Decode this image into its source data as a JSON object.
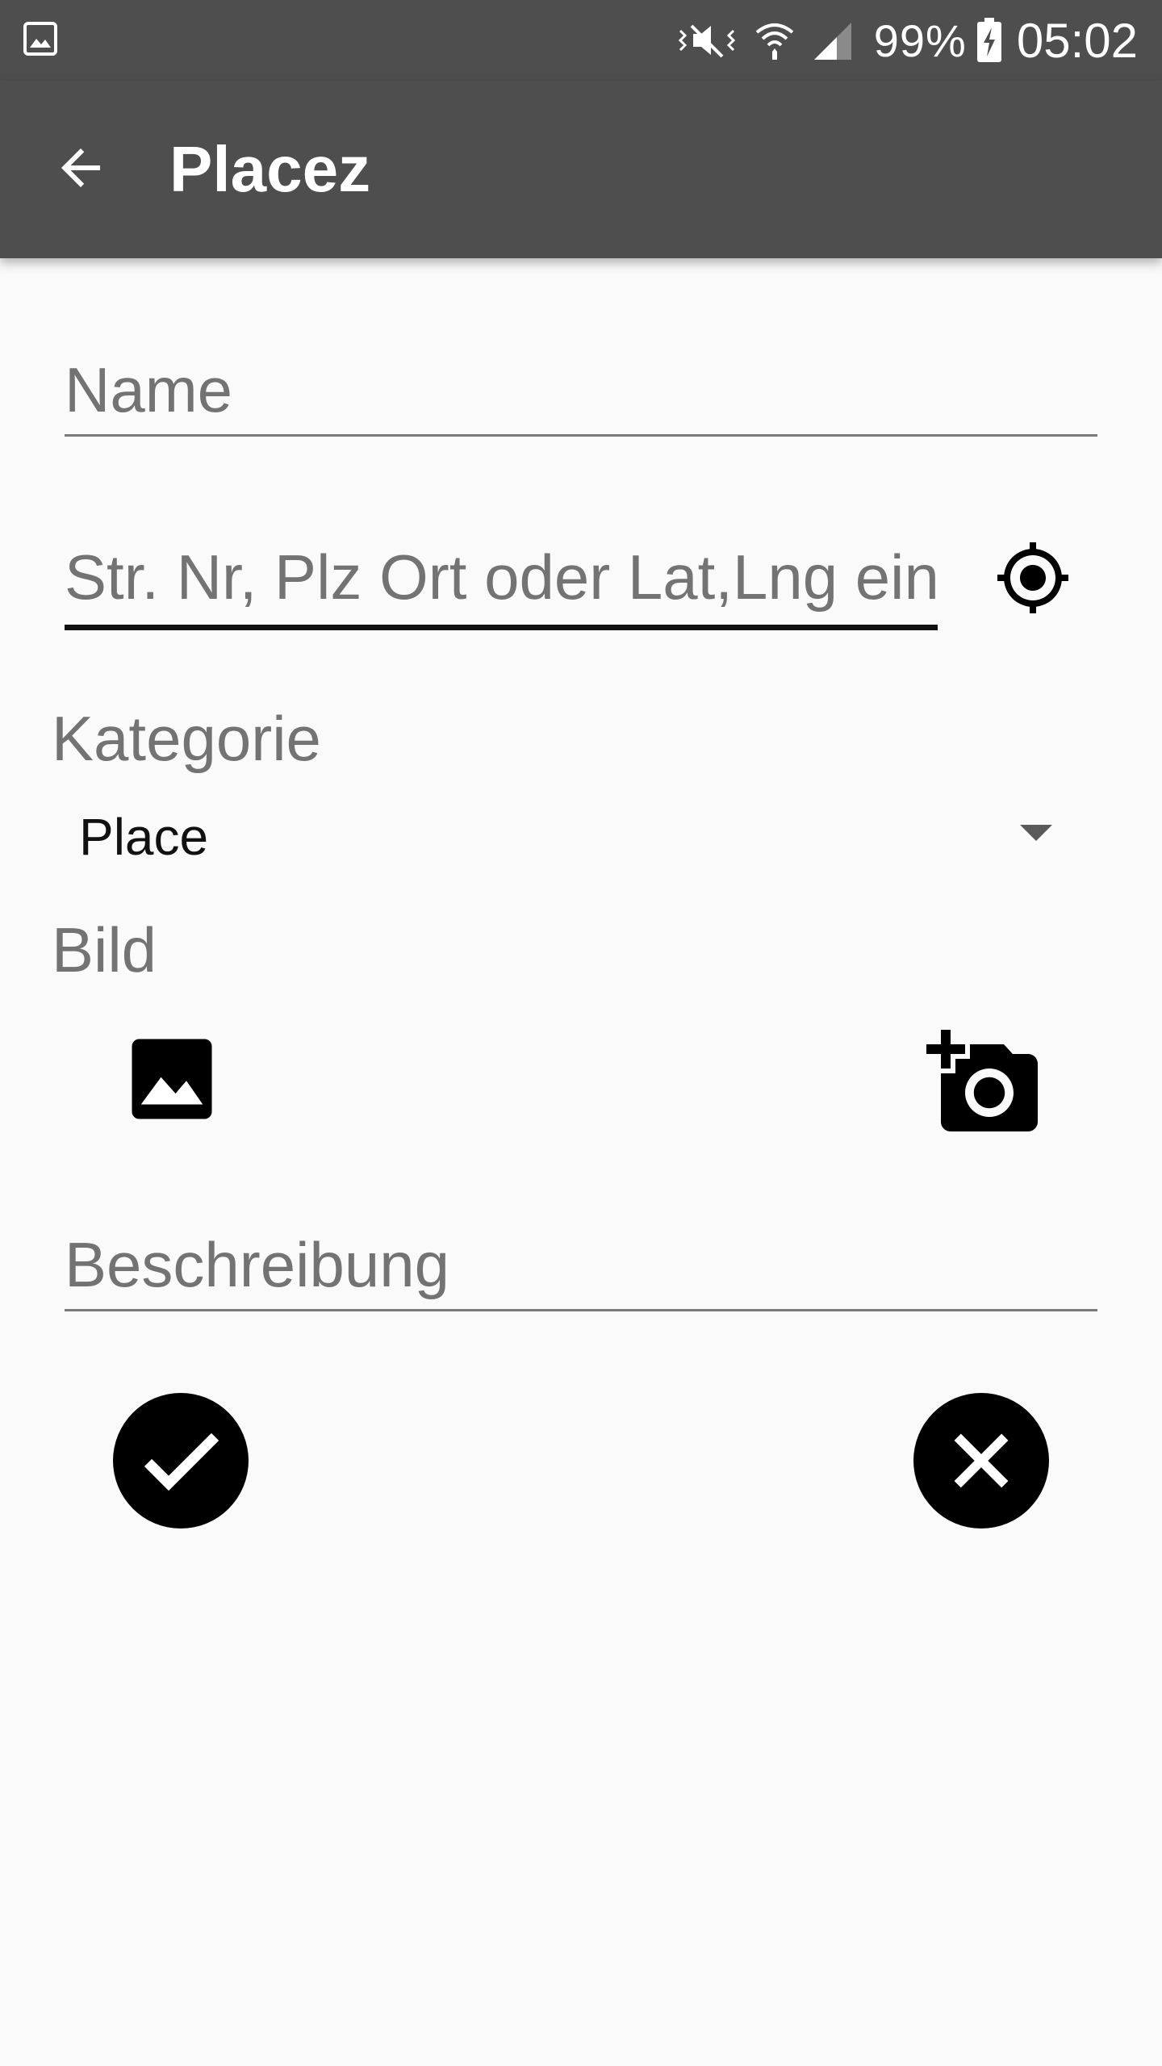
{
  "status_bar": {
    "battery_percent": "99%",
    "time": "05:02",
    "icons": [
      "gallery-notification-icon",
      "vibrate-icon",
      "wifi-icon",
      "cell-signal-icon",
      "battery-charging-icon"
    ]
  },
  "app_bar": {
    "title": "Placez",
    "back_icon": "arrow-back-icon"
  },
  "form": {
    "name": {
      "placeholder": "Name",
      "value": ""
    },
    "address": {
      "placeholder": "Str. Nr, Plz Ort oder Lat,Lng eingeben",
      "value": "",
      "locate_icon": "gps-fixed-icon"
    },
    "category": {
      "label": "Kategorie",
      "selected": "Place"
    },
    "image": {
      "label": "Bild",
      "gallery_icon": "image-icon",
      "camera_icon": "add-a-photo-icon"
    },
    "description": {
      "placeholder": "Beschreibung",
      "value": ""
    }
  },
  "actions": {
    "confirm_icon": "check-circle-icon",
    "cancel_icon": "cancel-circle-icon"
  },
  "colors": {
    "toolbar": "#4e4e4e",
    "background": "#fafafa",
    "hint_text": "#737373",
    "accent": "#000000"
  }
}
